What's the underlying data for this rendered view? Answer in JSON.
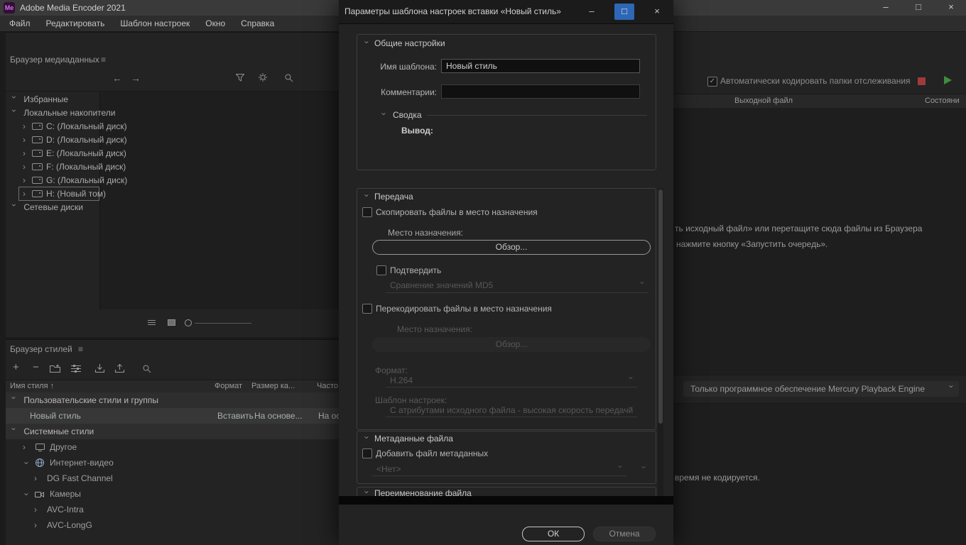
{
  "icons": {
    "menu": "≡",
    "back": "←",
    "forward": "→",
    "chevron": "›",
    "sort_asc": "↑",
    "minimize": "–",
    "maximize": "□",
    "close": "×",
    "check": "✓",
    "plus": "+",
    "minus": "−",
    "app_logo": "Me"
  },
  "main_window": {
    "title": "Adobe Media Encoder 2021",
    "menu": [
      "Файл",
      "Редактировать",
      "Шаблон настроек",
      "Окно",
      "Справка"
    ],
    "media_browser": {
      "title": "Браузер медиаданных",
      "tree": [
        {
          "label": "Избранные"
        },
        {
          "label": "Локальные накопители"
        },
        {
          "label": "C: (Локальный диск)"
        },
        {
          "label": "D: (Локальный диск)"
        },
        {
          "label": "E: (Локальный диск)"
        },
        {
          "label": "F: (Локальный диск)"
        },
        {
          "label": "G: (Локальный диск)"
        },
        {
          "label": "H: (Новый том)"
        },
        {
          "label": "Сетевые диски"
        }
      ]
    },
    "preset_browser": {
      "title": "Браузер стилей",
      "columns": [
        "Имя стиля",
        "Формат",
        "Размер ка...",
        "Часто..."
      ],
      "rows": [
        {
          "label": "Пользовательские стили и группы"
        },
        {
          "label": "Новый стиль",
          "format": "Вставить",
          "frame_size": "На основе...",
          "frame_rate": "На ос..."
        },
        {
          "label": "Системные стили"
        },
        {
          "label": "Другое"
        },
        {
          "label": "Интернет-видео"
        },
        {
          "label": "DG Fast Channel"
        },
        {
          "label": "Камеры"
        },
        {
          "label": "AVC-Intra"
        },
        {
          "label": "AVC-LongG"
        }
      ]
    },
    "queue": {
      "watch_label": "Автоматически кодировать папки отслеживания",
      "output_column": "Выходной файл",
      "status_column": "Состояни",
      "hint_line1": "ть исходный файл» или перетащите сюда файлы из Браузера",
      "hint_line2": "нажмите кнопку «Запустить очередь».",
      "renderer": "Только программное обеспечение Mercury Playback Engine",
      "status_fragment": "время не кодируется."
    }
  },
  "dialog": {
    "title": "Параметры шаблона настроек вставки «Новый стиль»",
    "general": {
      "header": "Общие настройки",
      "name_label": "Имя шаблона:",
      "name_value": "Новый стиль",
      "comments_label": "Комментарии:",
      "summary_header": "Сводка",
      "output_label": "Вывод:"
    },
    "transfer": {
      "header": "Передача",
      "copy_label": "Скопировать файлы в место назначения",
      "dest_label": "Место назначения:",
      "browse_label": "Обзор...",
      "verify_label": "Подтвердить",
      "verify_mode": "Сравнение значений MD5",
      "transcode_label": "Перекодировать файлы в место назначения",
      "dest2_label": "Место назначения:",
      "browse2_label": "Обзор...",
      "format_label": "Формат:",
      "format_value": "H.264",
      "preset_label": "Шаблон настроек:",
      "preset_value": "С атрибутами исходного файла - высокая скорость передачи"
    },
    "metadata": {
      "header": "Метаданные файла",
      "add_label": "Добавить файл метаданных",
      "value": "<Нет>"
    },
    "rename": {
      "header": "Переименование файла"
    },
    "buttons": {
      "ok": "ОК",
      "cancel": "Отмена"
    }
  }
}
